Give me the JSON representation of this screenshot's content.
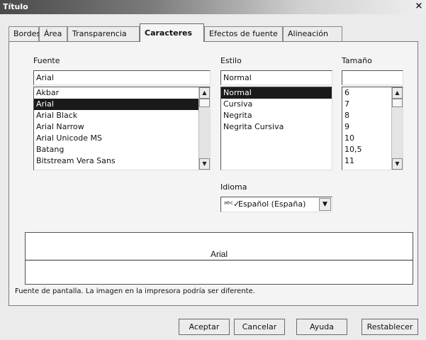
{
  "window": {
    "title": "Título",
    "close_glyph": "×"
  },
  "tabs": [
    {
      "label": "Bordes"
    },
    {
      "label": "Área"
    },
    {
      "label": "Transparencia"
    },
    {
      "label": "Caracteres",
      "active": true
    },
    {
      "label": "Efectos de fuente"
    },
    {
      "label": "Alineación"
    }
  ],
  "font": {
    "label": "Fuente",
    "value": "Arial",
    "items": [
      "Akbar",
      "Arial",
      "Arial Black",
      "Arial Narrow",
      "Arial Unicode MS",
      "Batang",
      "Bitstream Vera Sans"
    ],
    "selected_index": 1
  },
  "style": {
    "label": "Estilo",
    "value": "Normal",
    "items": [
      "Normal",
      "Cursiva",
      "Negrita",
      "Negrita Cursiva"
    ],
    "selected_index": 0
  },
  "size": {
    "label": "Tamaño",
    "value": "",
    "items": [
      "6",
      "7",
      "8",
      "9",
      "10",
      "10,5",
      "11"
    ]
  },
  "language": {
    "label": "Idioma",
    "value": "Español (España)",
    "icon": "spellcheck-icon",
    "glyph": "ᵃᵇᶜ✓"
  },
  "preview": {
    "text": "Arial"
  },
  "note": "Fuente de pantalla. La imagen en la impresora podría ser diferente.",
  "buttons": {
    "ok": "Aceptar",
    "cancel": "Cancelar",
    "help": "Ayuda",
    "reset": "Restablecer"
  }
}
